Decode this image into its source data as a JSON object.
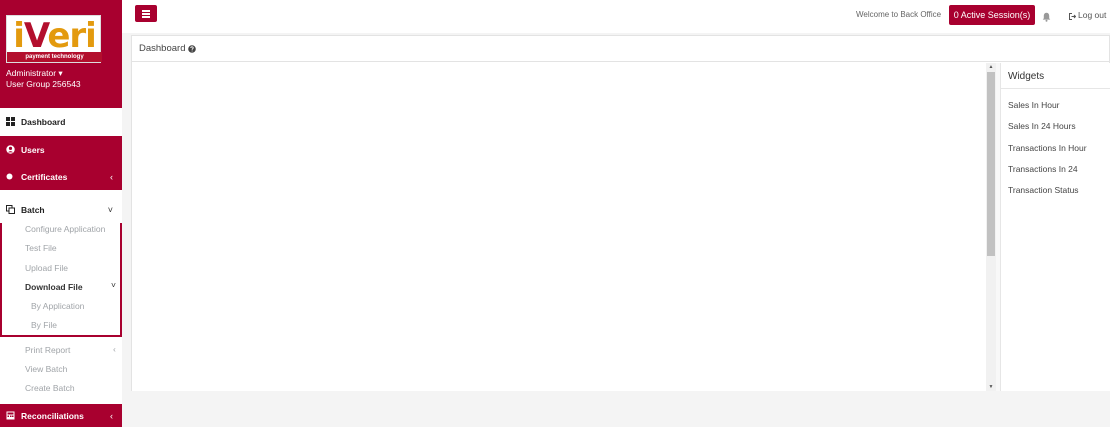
{
  "brand": {
    "logo_text_a": "i",
    "logo_text_v": "V",
    "logo_text_b": "eri",
    "tagline": "payment technology"
  },
  "user": {
    "name": "Administrator ▾",
    "group": "User Group 256543"
  },
  "nav": {
    "dashboard": "Dashboard",
    "users": "Users",
    "certificates": "Certificates",
    "batch": "Batch",
    "batch_children": [
      "Configure Application",
      "Test File",
      "Upload File",
      "Download File"
    ],
    "download_children": [
      "By Application",
      "By File"
    ],
    "print_report": "Print Report",
    "view_batch": "View Batch",
    "create_batch": "Create Batch",
    "reconciliations": "Reconciliations",
    "chevron_left": "‹",
    "chevron_down": "˅"
  },
  "topbar": {
    "welcome": "Welcome to Back Office",
    "active_sessions": "0 Active Session(s)",
    "logout": "Log out"
  },
  "dashboard": {
    "title": "Dashboard"
  },
  "widgets": {
    "title": "Widgets",
    "items": [
      "Sales In Hour",
      "Sales In 24 Hours",
      "Transactions In Hour",
      "Transactions In 24",
      "Transaction Status"
    ]
  },
  "colors": {
    "brand_red": "#a8002f",
    "logo_orange": "#e39a0e"
  }
}
